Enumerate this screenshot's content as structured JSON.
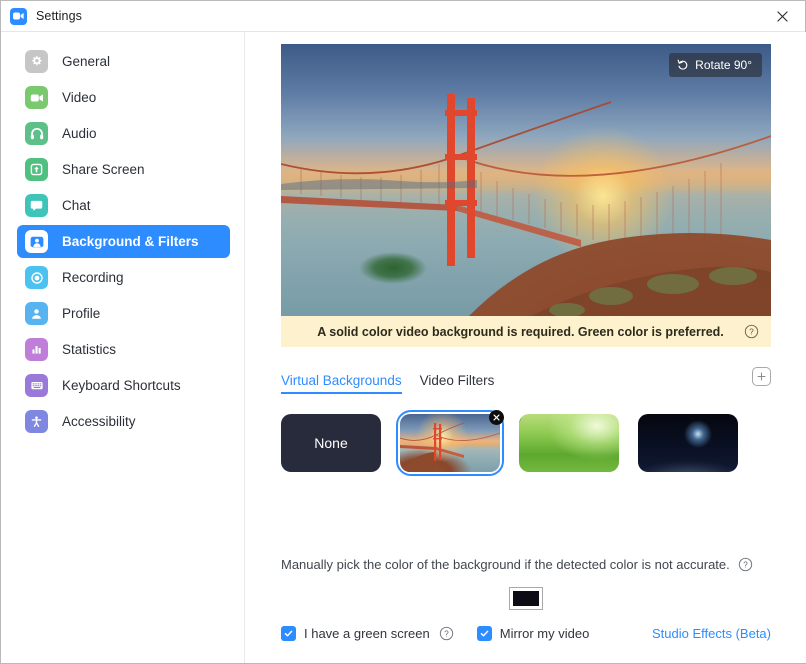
{
  "window": {
    "title": "Settings",
    "app_icon": "zoom-camera-icon",
    "close_icon": "close-icon"
  },
  "sidebar": {
    "items": [
      {
        "label": "General",
        "icon": "gear-icon",
        "color": "#c6c6c6",
        "selected": false
      },
      {
        "label": "Video",
        "icon": "video-camera-icon",
        "color": "#7bc96f",
        "selected": false
      },
      {
        "label": "Audio",
        "icon": "headphones-icon",
        "color": "#5dc08a",
        "selected": false
      },
      {
        "label": "Share Screen",
        "icon": "share-screen-icon",
        "color": "#4fc07f",
        "selected": false
      },
      {
        "label": "Chat",
        "icon": "chat-bubble-icon",
        "color": "#3fc4ba",
        "selected": false
      },
      {
        "label": "Background & Filters",
        "icon": "person-frame-icon",
        "color": "#2d8cff",
        "selected": true
      },
      {
        "label": "Recording",
        "icon": "record-circle-icon",
        "color": "#4cc2f0",
        "selected": false
      },
      {
        "label": "Profile",
        "icon": "person-icon",
        "color": "#58b4f0",
        "selected": false
      },
      {
        "label": "Statistics",
        "icon": "bar-chart-icon",
        "color": "#bf7fd8",
        "selected": false
      },
      {
        "label": "Keyboard Shortcuts",
        "icon": "keyboard-icon",
        "color": "#9a7ad8",
        "selected": false
      },
      {
        "label": "Accessibility",
        "icon": "accessibility-icon",
        "color": "#7f87e0",
        "selected": false
      }
    ]
  },
  "preview": {
    "rotate_button_label": "Rotate 90°",
    "rotate_icon": "rotate-ccw-icon",
    "image_description": "Golden Gate Bridge at sunset"
  },
  "notice": {
    "text": "A solid color video background is required. Green color is preferred.",
    "help_icon": "help-circle-icon",
    "background_color": "#fdf2cd"
  },
  "tabs": {
    "items": [
      {
        "label": "Virtual Backgrounds",
        "active": true
      },
      {
        "label": "Video Filters",
        "active": false
      }
    ],
    "add_button_icon": "plus-icon",
    "accent_color": "#2d8cff"
  },
  "backgrounds": {
    "items": [
      {
        "label": "None",
        "kind": "none",
        "selected": false,
        "removable": false
      },
      {
        "label": "Golden Gate Bridge",
        "kind": "bridge",
        "selected": true,
        "removable": true,
        "remove_icon": "close-circle-icon"
      },
      {
        "label": "Grass",
        "kind": "grass",
        "selected": false,
        "removable": false
      },
      {
        "label": "Earth from space",
        "kind": "earth",
        "selected": false,
        "removable": false
      }
    ]
  },
  "manual_color": {
    "text": "Manually pick the color of the background if the detected color is not accurate.",
    "help_icon": "help-circle-icon",
    "swatch_color": "#0d0c15"
  },
  "bottom": {
    "green_screen": {
      "label": "I have a green screen",
      "checked": true,
      "help_icon": "help-circle-icon"
    },
    "mirror_video": {
      "label": "Mirror my video",
      "checked": true
    },
    "studio_effects_link": "Studio Effects (Beta)"
  }
}
